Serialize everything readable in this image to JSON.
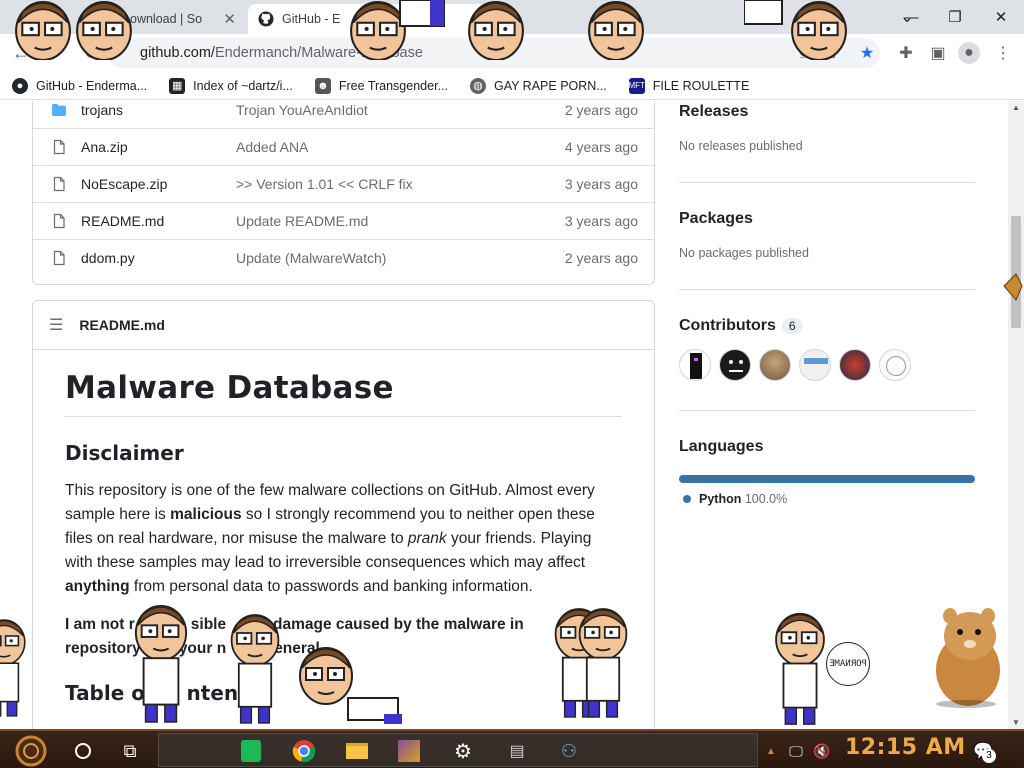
{
  "browser": {
    "tabs": [
      {
        "title": "ownload | So",
        "active": false
      },
      {
        "title": "GitHub - E",
        "active": true
      }
    ],
    "url_host": "github.com/",
    "url_path": "Endermanch/Malware-Database",
    "bookmarks": [
      {
        "label": "GitHub - Enderma...",
        "icon": "github-icon"
      },
      {
        "label": "Index of ~dartz/i...",
        "icon": "folder-icon"
      },
      {
        "label": "Free Transgender...",
        "icon": "site-icon"
      },
      {
        "label": "GAY RAPE PORN...",
        "icon": "globe-icon"
      },
      {
        "label": "FILE ROULETTE",
        "icon": "mft-icon"
      }
    ],
    "window_controls": {
      "minimize": "—",
      "restore": "❐",
      "close": "✕"
    }
  },
  "files": [
    {
      "name": "trojans",
      "message": "Trojan YouAreAnIdiot",
      "time": "2 years ago",
      "type": "folder"
    },
    {
      "name": "Ana.zip",
      "message": "Added ANA",
      "time": "4 years ago",
      "type": "file"
    },
    {
      "name": "NoEscape.zip",
      "message": ">> Version 1.01 << CRLF fix",
      "time": "3 years ago",
      "type": "file"
    },
    {
      "name": "README.md",
      "message": "Update README.md",
      "time": "3 years ago",
      "type": "file"
    },
    {
      "name": "ddom.py",
      "message": "Update (MalwareWatch)",
      "time": "2 years ago",
      "type": "file"
    }
  ],
  "readme": {
    "header": "README.md",
    "title": "Malware Database",
    "disclaimer_heading": "Disclaimer",
    "p1_a": "This repository is one of the few malware collections on GitHub. Almost every sample here is ",
    "p1_b": "malicious",
    "p1_c": " so I strongly recommend you to neither open these files on real hardware, nor misuse the malware to ",
    "p1_d": "prank",
    "p1_e": " your friends. Playing with these samples may lead to irreversible consequences which may affect ",
    "p1_f": "anything",
    "p1_g": " from personal data to passwords and banking information.",
    "p2_a": "I am not r",
    "p2_b": "sible",
    "p2_c": "y damage caused by the malware in",
    "p2_d": "repository",
    "p2_e": "your n",
    "p2_f": "eneral.",
    "toc_a": "Table of c",
    "toc_b": "ntents"
  },
  "sidebar": {
    "releases_heading": "Releases",
    "releases_text": "No releases published",
    "packages_heading": "Packages",
    "packages_text": "No packages published",
    "contributors_heading": "Contributors",
    "contributors_count": "6",
    "languages_heading": "Languages",
    "language_name": "Python",
    "language_percent": "100.0%",
    "language_color": "#3572a5"
  },
  "taskbar": {
    "time": "12:15 AM",
    "notification_count": "3"
  },
  "overlay": {
    "bubble_text": "ƎMAИЯOꟼ"
  }
}
